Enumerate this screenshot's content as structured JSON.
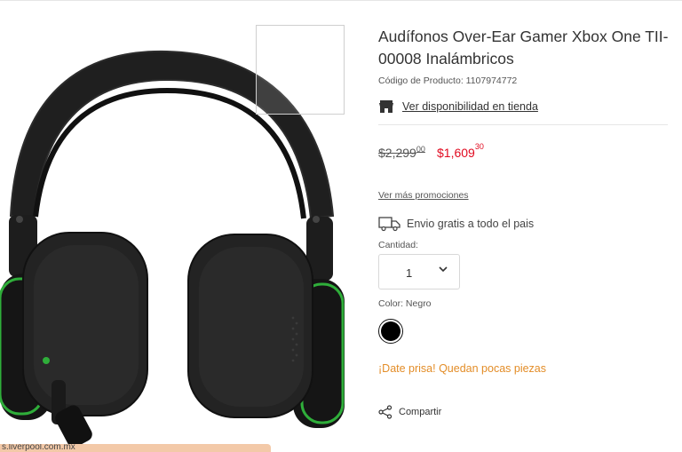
{
  "product": {
    "title": "Audífonos Over-Ear Gamer Xbox One TII-00008 Inalámbricos",
    "sku": "Código de Producto: 1107974772",
    "store_availability_label": "Ver disponibilidad en tienda",
    "price_old_main": "$2,299",
    "price_old_cents": "00",
    "price_new_main": "$1,609",
    "price_new_cents": "30",
    "promotions_label": "Ver más promociones",
    "shipping_label": "Envio gratis a todo el pais",
    "quantity_label": "Cantidad:",
    "quantity_value": "1",
    "color_label": "Color: Negro",
    "stock_alert": "¡Date prisa! Quedan pocas piezas",
    "share_label": "Compartir"
  },
  "browser": {
    "status_url": "s.liverpool.com.mx"
  },
  "colors": {
    "sale_price": "#e10a20",
    "stock_alert": "#e38d28",
    "headset_accent": "#2fae3a"
  },
  "icons": [
    "store-icon",
    "truck-icon",
    "chevron-down-icon",
    "share-icon"
  ]
}
